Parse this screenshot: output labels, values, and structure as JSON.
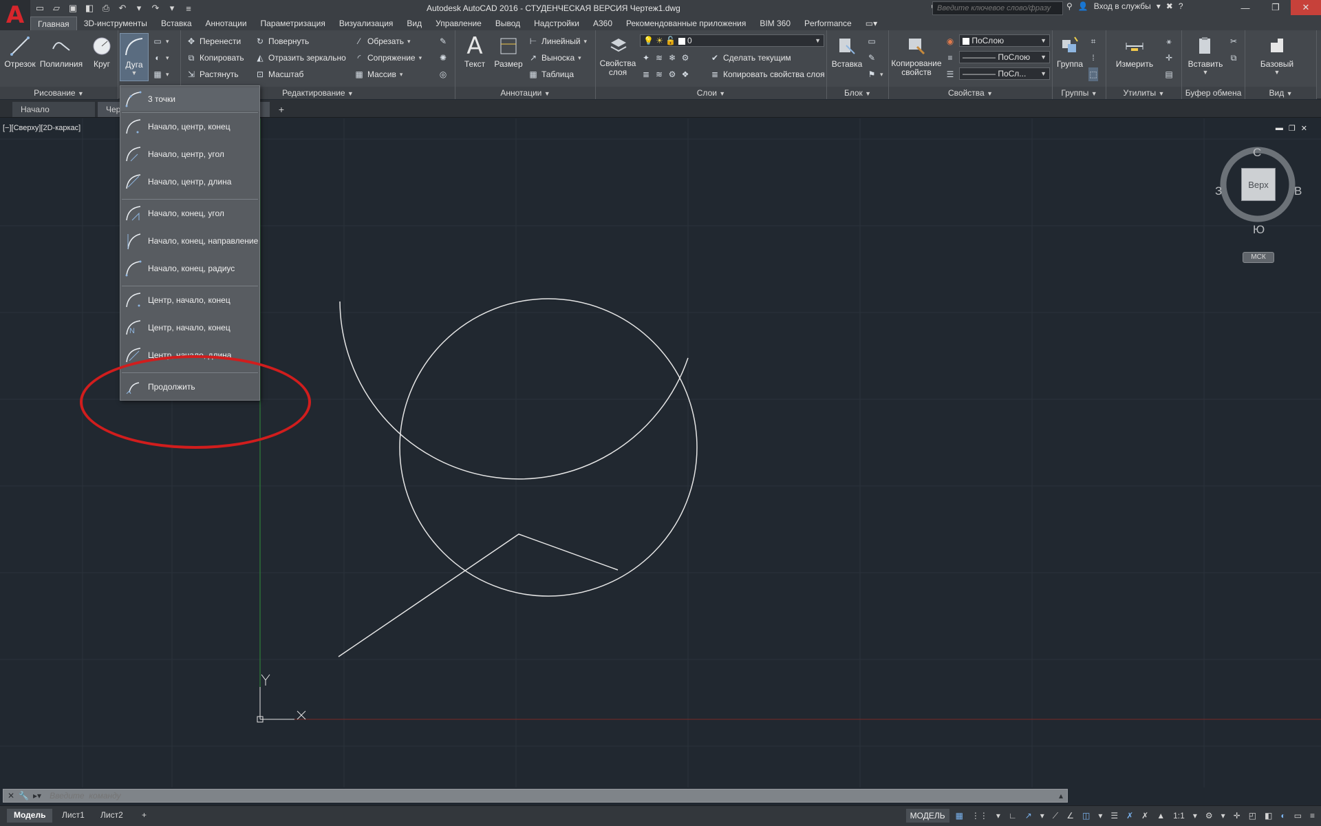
{
  "titlebar": {
    "title": "Autodesk AutoCAD 2016 - СТУДЕНЧЕСКАЯ ВЕРСИЯ    Чертеж1.dwg",
    "search_placeholder": "Введите ключевое слово/фразу",
    "signin_label": "Вход в службы"
  },
  "ribbon_tabs": [
    "Главная",
    "3D-инструменты",
    "Вставка",
    "Аннотации",
    "Параметризация",
    "Визуализация",
    "Вид",
    "Управление",
    "Вывод",
    "Надстройки",
    "A360",
    "Рекомендованные приложения",
    "BIM 360",
    "Performance"
  ],
  "ribbon": {
    "draw": {
      "title": "Рисование",
      "line": "Отрезок",
      "polyline": "Полилиния",
      "circle": "Круг",
      "arc": "Дуга"
    },
    "modify": {
      "title": "Редактирование",
      "move": "Перенести",
      "rotate": "Повернуть",
      "trim": "Обрезать",
      "copy": "Копировать",
      "mirror": "Отразить зеркально",
      "fillet": "Сопряжение",
      "stretch": "Растянуть",
      "scale": "Масштаб",
      "array": "Массив"
    },
    "annotation": {
      "title": "Аннотации",
      "text": "Текст",
      "dimension": "Размер",
      "linear": "Линейный",
      "leader": "Выноска",
      "table": "Таблица"
    },
    "layers": {
      "title": "Слои",
      "layer_properties": "Свойства слоя",
      "layer_value": "0",
      "make_current": "Сделать текущим",
      "match_layer": "Копировать свойства слоя"
    },
    "block": {
      "title": "Блок",
      "insert": "Вставка"
    },
    "properties": {
      "title": "Свойства",
      "match_properties": "Копирование свойств",
      "color_value": "ПоСлою",
      "linetype_value": "ПоСлою",
      "lineweight_value": "ПоСл..."
    },
    "groups": {
      "title": "Группы",
      "group": "Группа"
    },
    "utilities": {
      "title": "Утилиты",
      "measure": "Измерить"
    },
    "clipboard": {
      "title": "Буфер обмена",
      "paste": "Вставить"
    },
    "view": {
      "title": "Вид",
      "base": "Базовый"
    }
  },
  "file_tabs": {
    "start": "Начало",
    "drawing": "Чер"
  },
  "viewport": {
    "label": "[−][Сверху][2D-каркас]",
    "viewcube_face": "Верх",
    "compass_n": "С",
    "compass_s": "Ю",
    "compass_e": "В",
    "compass_w": "З",
    "wcs": "МСК",
    "ucs_x": "X",
    "ucs_y": "Y"
  },
  "arc_menu": {
    "items": [
      "3 точки",
      "Начало, центр, конец",
      "Начало, центр, угол",
      "Начало, центр, длина",
      "Начало, конец, угол",
      "Начало, конец, направление",
      "Начало, конец, радиус",
      "Центр, начало, конец",
      "Центр, начало, конец",
      "Центр, начало, длина",
      "Продолжить"
    ]
  },
  "cmdline": {
    "placeholder": "Введите  команду"
  },
  "statusbar": {
    "tabs": [
      "Модель",
      "Лист1",
      "Лист2"
    ],
    "model_label": "МОДЕЛЬ",
    "scale": "1:1"
  },
  "colors": {
    "background": "#212830",
    "ribbon": "#44484d",
    "highlight": "#d11d1d",
    "logo": "#d7262c"
  }
}
